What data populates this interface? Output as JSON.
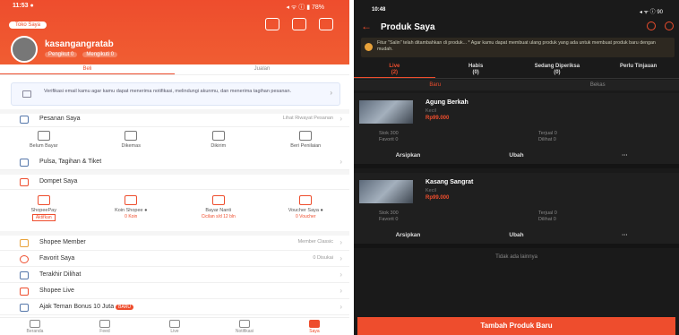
{
  "left": {
    "status_time": "11:53 ●",
    "status_right": "◂ ᯤ ⓘ ▮ 78%",
    "seller_badge": "Toko Saya",
    "username": "kasangangratab",
    "follow": [
      "Pengikut 0",
      "Mengikuti 0"
    ],
    "tabs": [
      "Beli",
      "Jualan"
    ],
    "verify_text": "Verifikasi email kamu agar kamu dapat menerima notifikasi, melindungi akunmu, dan menerima tagihan pesanan.",
    "orders_label": "Pesanan Saya",
    "orders_right": "Lihat Riwayat Pesanan",
    "order_status": [
      "Belum Bayar",
      "Dikemas",
      "Dikirim",
      "Beri Penilaian"
    ],
    "pulsa_label": "Pulsa, Tagihan & Tiket",
    "dompet_label": "Dompet Saya",
    "dompet": [
      {
        "name": "ShopeePay",
        "sub": "",
        "btn": "Aktifkan"
      },
      {
        "name": "Koin Shopee ●",
        "sub": "0 Koin",
        "btn": ""
      },
      {
        "name": "Bayar Nanti",
        "sub": "Cicilan s/d 12 bln",
        "btn": ""
      },
      {
        "name": "Voucher Saya ●",
        "sub": "0 Voucher",
        "btn": ""
      }
    ],
    "menu": [
      {
        "label": "Shopee Member",
        "right": "Member Classic"
      },
      {
        "label": "Favorit Saya",
        "right": "0 Disukai"
      },
      {
        "label": "Terakhir Dilihat",
        "right": ""
      },
      {
        "label": "Shopee Live",
        "right": ""
      },
      {
        "label": "Ajak Teman Bonus 10 Juta",
        "right": "",
        "badge": "BARU"
      }
    ],
    "bottom_nav": [
      "Beranda",
      "Feed",
      "Live",
      "Notifikasi",
      "Saya"
    ]
  },
  "right": {
    "status_time": "10:48",
    "status_right": "◂ ᯤ ⓘ 90",
    "title": "Produk Saya",
    "banner": "Fitur \"Salin\" telah ditambahkan di produk... * Agar kamu dapat membuat ulang produk yang ada untuk membuat produk baru dengan mudah.",
    "tabs": [
      {
        "label": "Live",
        "count": "(2)"
      },
      {
        "label": "Habis",
        "count": "(0)"
      },
      {
        "label": "Sedang Diperiksa",
        "count": "(0)"
      },
      {
        "label": "Perlu Tinjauan",
        "count": ""
      }
    ],
    "subtabs": [
      "Baru",
      "Bekas"
    ],
    "products": [
      {
        "name": "Agung Berkah",
        "variant": "Kecil",
        "price": "Rp99.000",
        "stock": "Stok 300",
        "sold": "Terjual 0",
        "fav": "Favorit 0",
        "views": "Dilihat 0",
        "act1": "Arsipkan",
        "act2": "Ubah",
        "act3": "···"
      },
      {
        "name": "Kasang Sangrat",
        "variant": "Kecil",
        "price": "Rp99.000",
        "stock": "Stok 300",
        "sold": "Terjual 0",
        "fav": "Favorit 0",
        "views": "Dilihat 0",
        "act1": "Arsipkan",
        "act2": "Ubah",
        "act3": "···"
      }
    ],
    "end_text": "Tidak ada lainnya",
    "add_button": "Tambah Produk Baru"
  },
  "colors": {
    "accent": "#ee4d2d",
    "dark_bg": "#1a1a1a"
  }
}
